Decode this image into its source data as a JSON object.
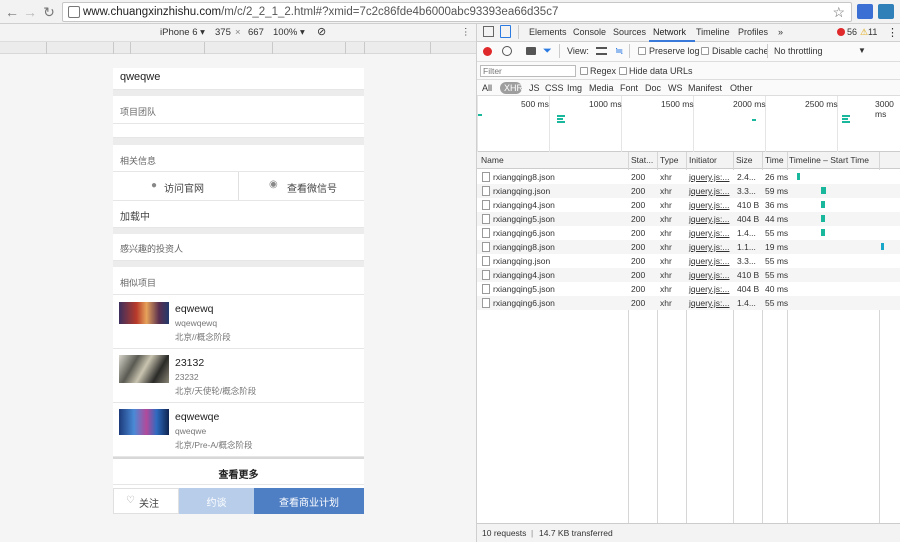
{
  "browser": {
    "url_host": "www.chuangxinzhishu.com",
    "url_path": "/m/c/2_2_1_2.html#?xmid=7c2c86fde4b6000abc93393ea66d35c7"
  },
  "device_toolbar": {
    "device": "iPhone 6",
    "width": "375",
    "times": "×",
    "height": "667",
    "zoom": "100%"
  },
  "mobile": {
    "project_name": "qweqwe",
    "team_label": "项目团队",
    "related_label": "相关信息",
    "visit_site": "访问官网",
    "view_wechat": "查看微信号",
    "loading": "加载中",
    "investors_label": "感兴趣的投资人",
    "similar_label": "相似项目",
    "projects": [
      {
        "name": "eqwewq",
        "desc": "wqewqewq",
        "tags": "北京//概念阶段"
      },
      {
        "name": "23132",
        "desc": "23232",
        "tags": "北京/天使轮/概念阶段"
      },
      {
        "name": "eqwewqe",
        "desc": "qweqwe",
        "tags": "北京/Pre-A/概念阶段"
      }
    ],
    "more": "查看更多",
    "follow": "关注",
    "appointment": "约谈",
    "view_plan": "查看商业计划"
  },
  "devtools": {
    "tabs": [
      "Elements",
      "Console",
      "Sources",
      "Network",
      "Timeline",
      "Profiles"
    ],
    "more_tabs": "»",
    "errors": "56",
    "warnings": "11",
    "view_label": "View:",
    "preserve_log": "Preserve log",
    "disable_cache": "Disable cache",
    "throttle": "No throttling",
    "filter_placeholder": "Filter",
    "regex": "Regex",
    "hide_data_urls": "Hide data URLs",
    "types": [
      "All",
      "XHR",
      "JS",
      "CSS",
      "Img",
      "Media",
      "Font",
      "Doc",
      "WS",
      "Manifest",
      "Other"
    ],
    "overview_ticks": [
      "500 ms",
      "1000 ms",
      "1500 ms",
      "2000 ms",
      "2500 ms",
      "3000 ms"
    ],
    "columns": [
      "Name",
      "Stat...",
      "Type",
      "Initiator",
      "Size",
      "Time",
      "Timeline – Start Time"
    ],
    "rows": [
      {
        "name": "rxiangqing8.json",
        "status": "200",
        "type": "xhr",
        "initiator": "jquery.js:...",
        "size": "2.4...",
        "time": "26 ms"
      },
      {
        "name": "rxiangqing.json",
        "status": "200",
        "type": "xhr",
        "initiator": "jquery.js:...",
        "size": "3.3...",
        "time": "59 ms"
      },
      {
        "name": "rxiangqing4.json",
        "status": "200",
        "type": "xhr",
        "initiator": "jquery.js:...",
        "size": "410 B",
        "time": "36 ms"
      },
      {
        "name": "rxiangqing5.json",
        "status": "200",
        "type": "xhr",
        "initiator": "jquery.js:...",
        "size": "404 B",
        "time": "44 ms"
      },
      {
        "name": "rxiangqing6.json",
        "status": "200",
        "type": "xhr",
        "initiator": "jquery.js:...",
        "size": "1.4...",
        "time": "55 ms"
      },
      {
        "name": "rxiangqing8.json",
        "status": "200",
        "type": "xhr",
        "initiator": "jquery.js:...",
        "size": "1.1...",
        "time": "19 ms"
      },
      {
        "name": "rxiangqing.json",
        "status": "200",
        "type": "xhr",
        "initiator": "jquery.js:...",
        "size": "3.3...",
        "time": "55 ms"
      },
      {
        "name": "rxiangqing4.json",
        "status": "200",
        "type": "xhr",
        "initiator": "jquery.js:...",
        "size": "410 B",
        "time": "55 ms"
      },
      {
        "name": "rxiangqing5.json",
        "status": "200",
        "type": "xhr",
        "initiator": "jquery.js:...",
        "size": "404 B",
        "time": "40 ms"
      },
      {
        "name": "rxiangqing6.json",
        "status": "200",
        "type": "xhr",
        "initiator": "jquery.js:...",
        "size": "1.4...",
        "time": "55 ms"
      }
    ],
    "status_requests": "10 requests",
    "status_sep": "|",
    "status_transferred": "14.7 KB transferred",
    "accent_color": "#19b89c",
    "record_color": "#e0292a"
  }
}
